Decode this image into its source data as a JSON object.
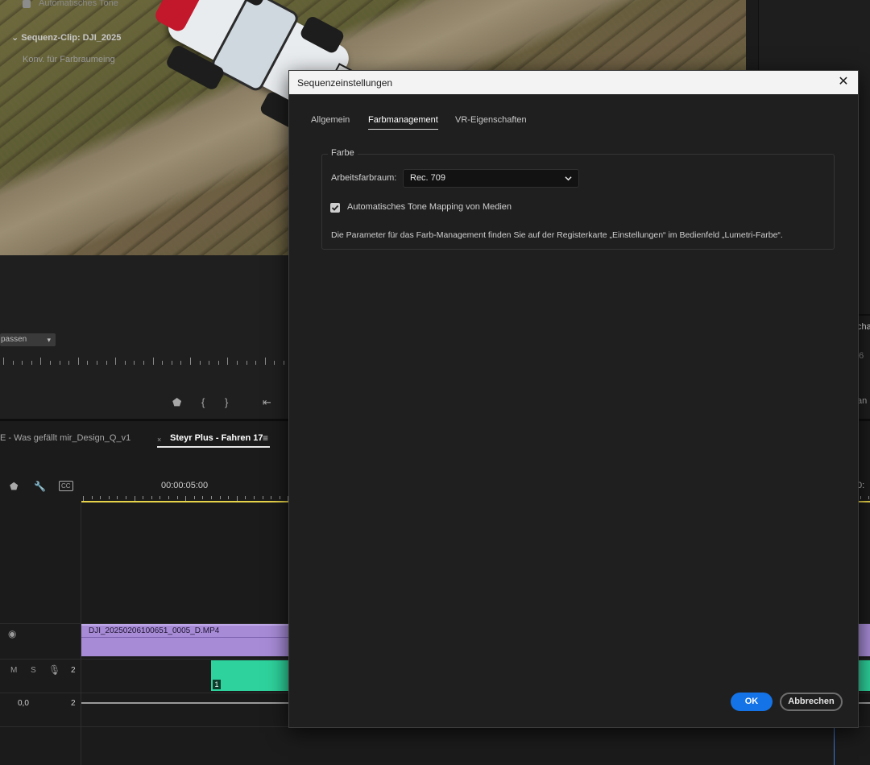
{
  "right_panel": {
    "checkbox_label": "Automatisches Tone",
    "sequence_clip": "Sequenz-Clip: DJI_2025",
    "conversion": "Konv. für Farbraumeing",
    "tab_partial": "cha",
    "tab_partial2": "06",
    "tab_partial3": "an"
  },
  "monitor": {
    "fit_dropdown": "passen"
  },
  "timeline": {
    "tab_inactive": "E - Was gefällt mir_Design_Q_v1",
    "tab_close": "×",
    "tab_active": "Steyr Plus - Fahren 17",
    "tab_menu": "≡",
    "timecode": "00:00:05:00",
    "timecode_right": "0:",
    "video_clip_label": "DJI_20250206100651_0005_D.MP4",
    "audio_clip_number": "1",
    "audio_track_m": "M",
    "audio_track_s": "S",
    "audio_track_num": "2",
    "master_value": "0,0",
    "master_num": "2"
  },
  "dialog": {
    "title": "Sequenzeinstellungen",
    "close_glyph": "✕",
    "tabs": [
      {
        "label": "Allgemein",
        "active": false
      },
      {
        "label": "Farbmanagement",
        "active": true
      },
      {
        "label": "VR-Eigenschaften",
        "active": false
      }
    ],
    "group_title": "Farbe",
    "working_color_space_label": "Arbeitsfarbraum:",
    "working_color_space_value": "Rec. 709",
    "tone_mapping_label": "Automatisches Tone Mapping von Medien",
    "tone_mapping_checked": true,
    "info_text": "Die Parameter für das Farb-Management finden Sie auf der Registerkarte „Einstellungen“ im Bedienfeld „Lumetri-Farbe“.",
    "ok_label": "OK",
    "cancel_label": "Abbrechen"
  },
  "colors": {
    "accent": "#1473e6",
    "video_clip": "#a78bd6",
    "audio_clip": "#2ed29c",
    "inout_bar": "#e7d34a"
  }
}
